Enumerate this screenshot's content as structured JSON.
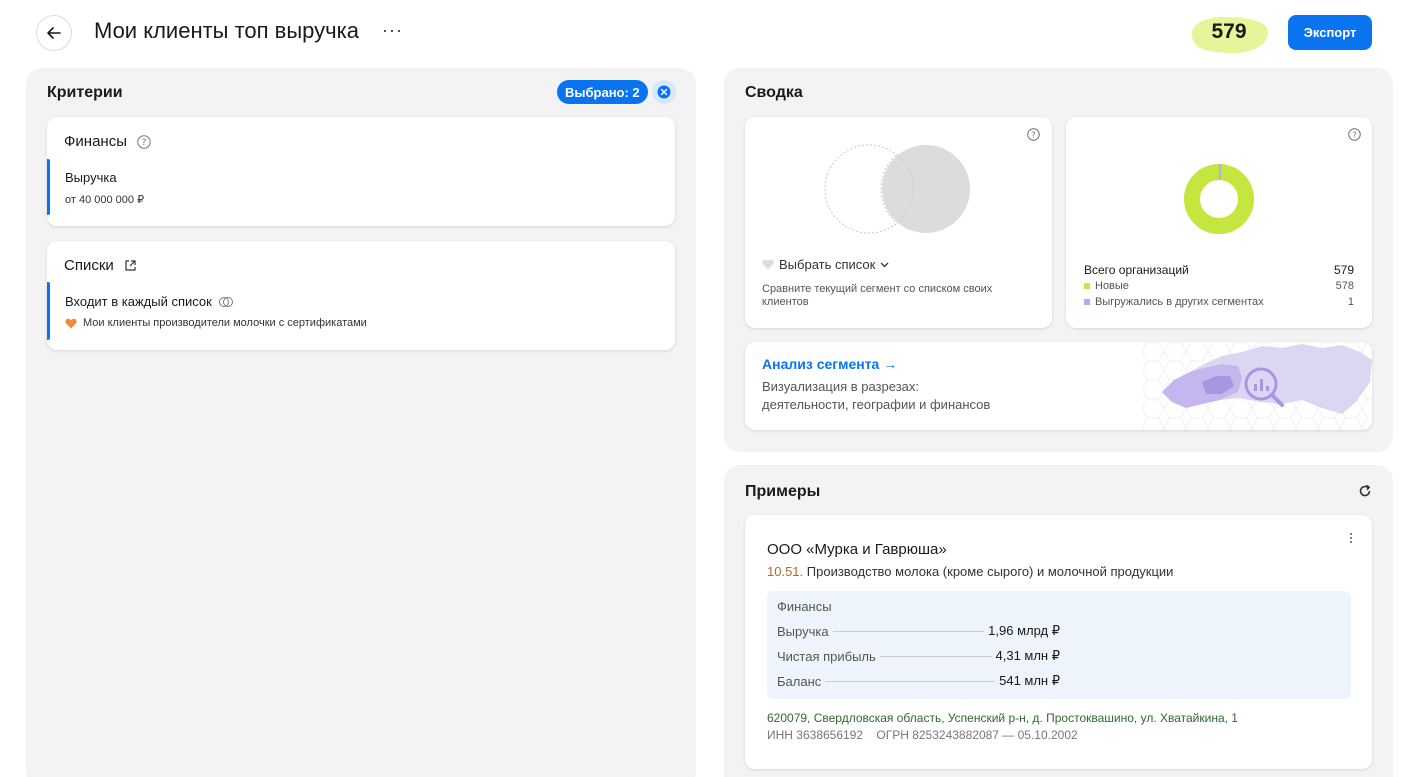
{
  "header": {
    "title": "Мои клиенты топ выручка",
    "more": "···",
    "count": "579",
    "export_label": "Экспорт"
  },
  "criteria": {
    "title": "Критерии",
    "selected_badge": "Выбрано: 2",
    "finance": {
      "title": "Финансы",
      "label": "Выручка",
      "value": "от 40 000 000 ₽"
    },
    "lists": {
      "title": "Списки",
      "label": "Входит в каждый список",
      "value": "Мои клиенты производители молочки с сертификатами"
    }
  },
  "summary": {
    "title": "Сводка",
    "compare": {
      "select_label": "Выбрать список",
      "description": "Сравните текущий сегмент со списком своих клиентов"
    },
    "orgs": {
      "total_label": "Всего организаций",
      "total_value": "579",
      "new_label": "Новые",
      "new_value": "578",
      "other_label": "Выгружались в других сегментах",
      "other_value": "1",
      "new_count": 578,
      "other_count": 1
    },
    "analysis": {
      "title": "Анализ сегмента →",
      "line1": "Визуализация в разрезах:",
      "line2": "деятельности, географии и финансов"
    }
  },
  "examples": {
    "title": "Примеры",
    "company": {
      "name": "ООО «Мурка и Гаврюша»",
      "okved_code": "10.51.",
      "okved_text": "Производство молока (кроме сырого) и молочной продукции",
      "finance_title": "Финансы",
      "rows": [
        {
          "label": "Выручка",
          "value": "1,96 млрд ₽"
        },
        {
          "label": "Чистая прибыль",
          "value": "4,31 млн ₽"
        },
        {
          "label": "Баланс",
          "value": "541 млн ₽"
        }
      ],
      "address": "620079, Свердловская область, Успенский р-н, д. Простоквашино, ул. Хватайкина, 1",
      "ids": "ИНН 3638656192    ОГРН 8253243882087 — 05.10.2002"
    }
  },
  "colors": {
    "accent": "#0a74f0",
    "new": "#c5e53f",
    "other": "#b9a6f5",
    "okved": "#b06a2c",
    "address": "#2e6b2e",
    "heart": "#f28a3c"
  }
}
